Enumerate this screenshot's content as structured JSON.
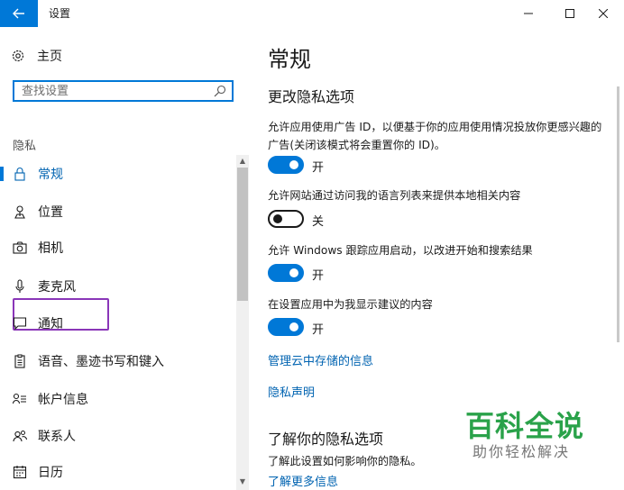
{
  "window": {
    "title": "设置",
    "accent_color": "#0078d7"
  },
  "sidebar": {
    "home_label": "主页",
    "search_placeholder": "查找设置",
    "section_label": "隐私",
    "items": [
      {
        "label": "常规",
        "icon": "lock-icon",
        "active": true
      },
      {
        "label": "位置",
        "icon": "location-icon",
        "active": false
      },
      {
        "label": "相机",
        "icon": "camera-icon",
        "active": false
      },
      {
        "label": "麦克风",
        "icon": "microphone-icon",
        "active": false,
        "highlighted": true
      },
      {
        "label": "通知",
        "icon": "notification-icon",
        "active": false
      },
      {
        "label": "语音、墨迹书写和键入",
        "icon": "clipboard-icon",
        "active": false
      },
      {
        "label": "帐户信息",
        "icon": "account-info-icon",
        "active": false
      },
      {
        "label": "联系人",
        "icon": "contacts-icon",
        "active": false
      },
      {
        "label": "日历",
        "icon": "calendar-icon",
        "active": false
      }
    ]
  },
  "main": {
    "title": "常规",
    "subtitle": "更改隐私选项",
    "options": [
      {
        "text": "允许应用使用广告 ID，以便基于你的应用使用情况投放你更感兴趣的广告(关闭该模式将会重置你的 ID)。",
        "state": "开",
        "on": true
      },
      {
        "text": "允许网站通过访问我的语言列表来提供本地相关内容",
        "state": "关",
        "on": false
      },
      {
        "text": "允许 Windows 跟踪应用启动，以改进开始和搜索结果",
        "state": "开",
        "on": true
      },
      {
        "text": "在设置应用中为我显示建议的内容",
        "state": "开",
        "on": true
      }
    ],
    "links": [
      "管理云中存储的信息",
      "隐私声明"
    ],
    "section2_title": "了解你的隐私选项",
    "section2_desc": "了解此设置如何影响你的隐私。",
    "section2_link": "了解更多信息"
  },
  "watermark": {
    "title": "百科全说",
    "subtitle": "助你轻松解决",
    "color": "#2aa24a"
  }
}
